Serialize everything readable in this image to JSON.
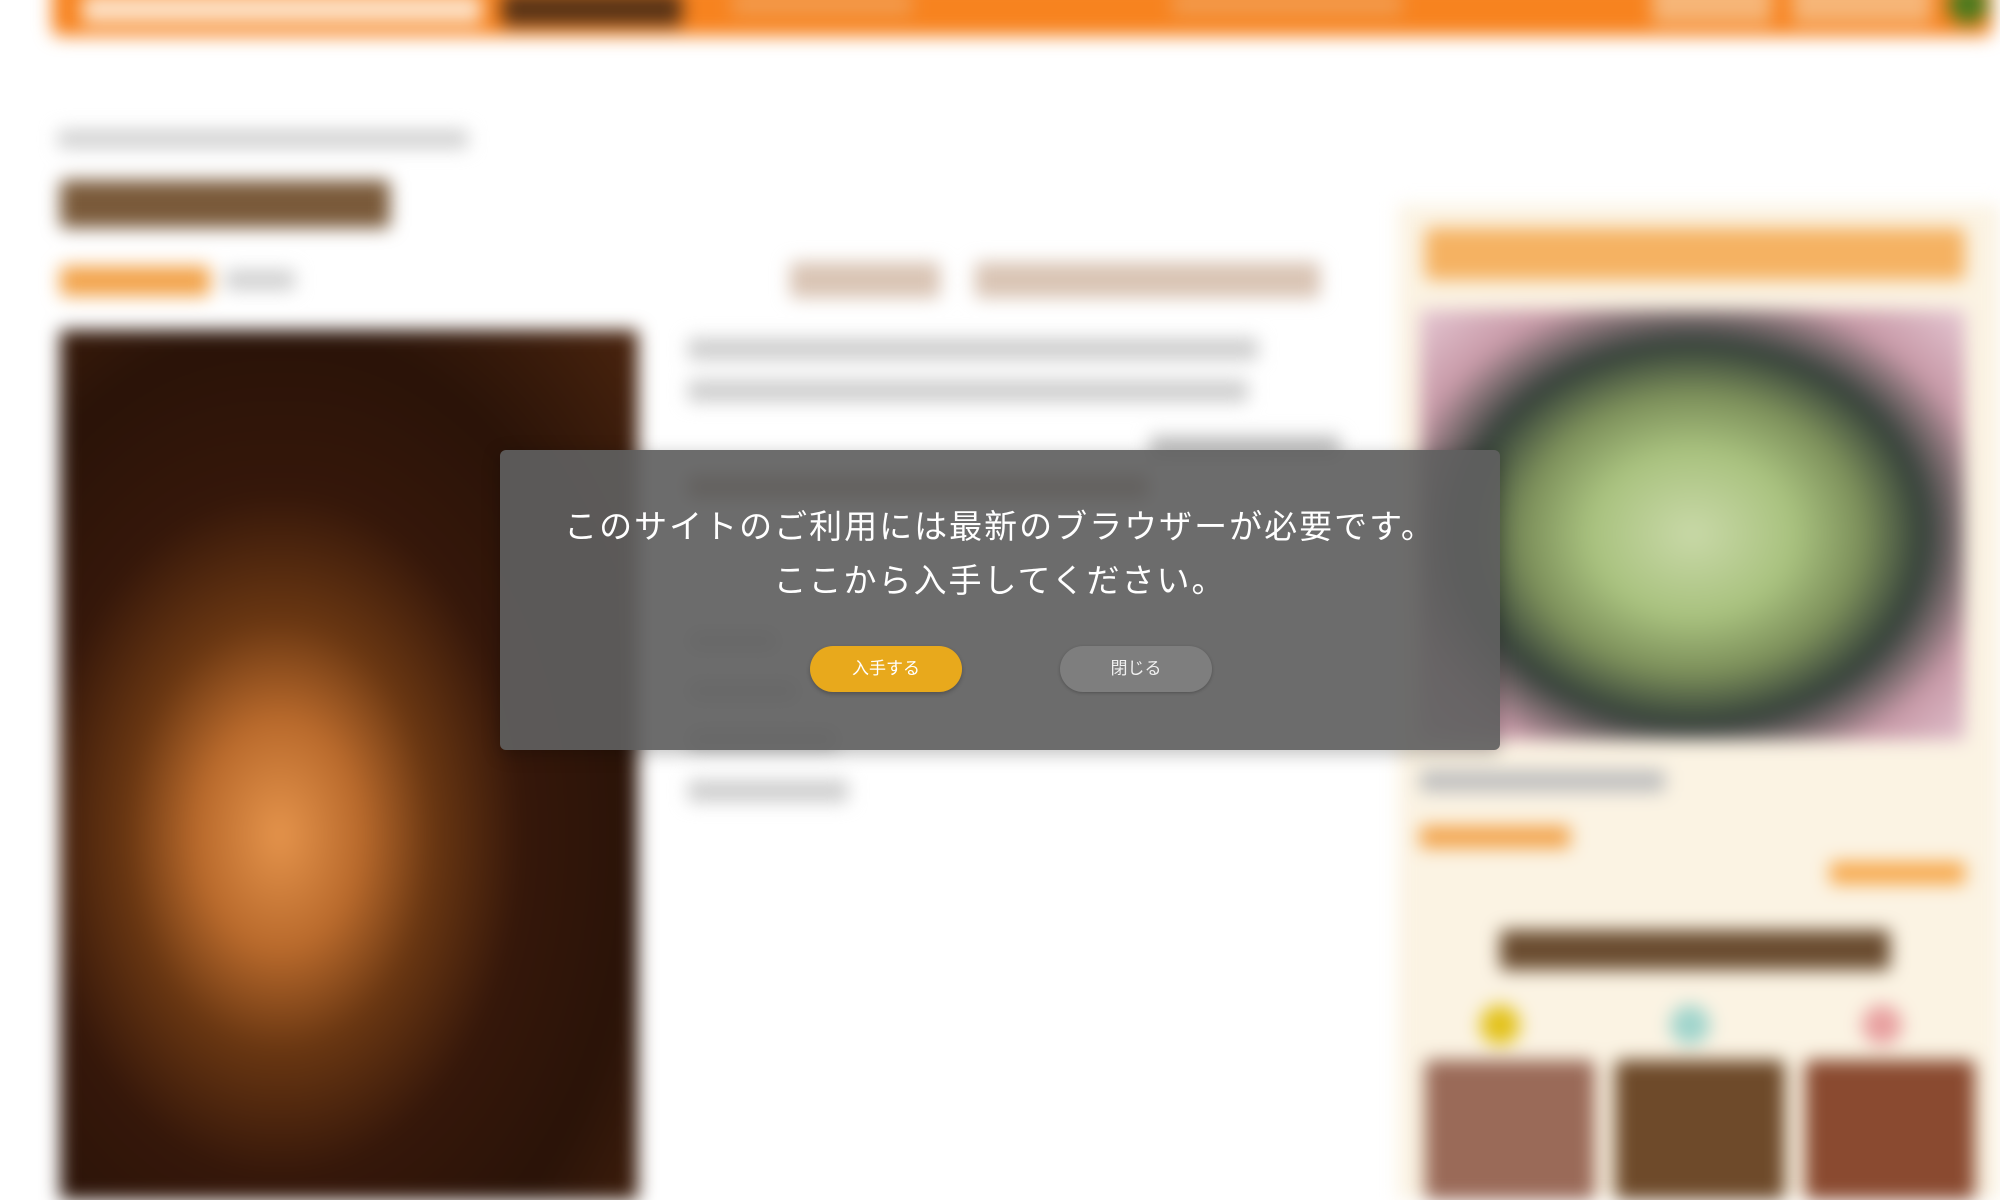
{
  "modal": {
    "message_line1": "このサイトのご利用には最新のブラウザーが必要です。",
    "message_line2": "ここから入手してください。",
    "get_button_label": "入手する",
    "close_button_label": "閉じる"
  },
  "colors": {
    "header_orange": "#f7831f",
    "get_button": "#e8a91c",
    "close_button": "#7e7e7e",
    "modal_background": "#5f5f5f"
  },
  "icons": [
    "search-icon",
    "avatar-icon"
  ]
}
